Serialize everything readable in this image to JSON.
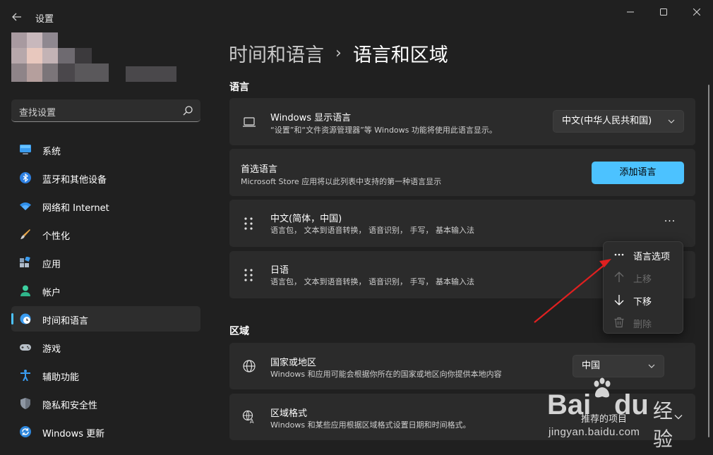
{
  "window": {
    "app_title": "设置",
    "back_icon": "arrow-left-icon",
    "controls": [
      "minimize-icon",
      "maximize-icon",
      "close-icon"
    ]
  },
  "search": {
    "placeholder": "查找设置",
    "icon": "search-icon"
  },
  "nav": {
    "items": [
      {
        "label": "系统",
        "icon": "monitor-icon",
        "active": false
      },
      {
        "label": "蓝牙和其他设备",
        "icon": "bluetooth-icon",
        "active": false
      },
      {
        "label": "网络和 Internet",
        "icon": "wifi-icon",
        "active": false
      },
      {
        "label": "个性化",
        "icon": "paintbrush-icon",
        "active": false
      },
      {
        "label": "应用",
        "icon": "apps-icon",
        "active": false
      },
      {
        "label": "帐户",
        "icon": "person-icon",
        "active": false
      },
      {
        "label": "时间和语言",
        "icon": "clock-globe-icon",
        "active": true
      },
      {
        "label": "游戏",
        "icon": "gamepad-icon",
        "active": false
      },
      {
        "label": "辅助功能",
        "icon": "accessibility-icon",
        "active": false
      },
      {
        "label": "隐私和安全性",
        "icon": "shield-icon",
        "active": false
      },
      {
        "label": "Windows 更新",
        "icon": "update-icon",
        "active": false
      }
    ]
  },
  "breadcrumb": {
    "parent": "时间和语言",
    "separator": "›",
    "current": "语言和区域"
  },
  "language_section": {
    "heading": "语言",
    "display_language": {
      "title": "Windows 显示语言",
      "subtitle": "“设置”和“文件资源管理器”等 Windows 功能将使用此语言显示。",
      "value": "中文(中华人民共和国)",
      "icon": "laptop-icon"
    },
    "preferred": {
      "title": "首选语言",
      "subtitle": "Microsoft Store 应用将以此列表中支持的第一种语言显示",
      "button": "添加语言"
    },
    "languages": [
      {
        "name": "中文(简体，中国)",
        "features": "语言包，  文本到语音转换，  语音识别，  手写，  基本输入法"
      },
      {
        "name": "日语",
        "features": "语言包，  文本到语音转换，  语音识别，  手写，  基本输入法"
      }
    ],
    "more_label": "···"
  },
  "context_menu": {
    "items": [
      {
        "label": "语言选项",
        "icon": "more-icon",
        "enabled": true
      },
      {
        "label": "上移",
        "icon": "arrow-up-icon",
        "enabled": false
      },
      {
        "label": "下移",
        "icon": "arrow-down-icon",
        "enabled": true
      },
      {
        "label": "删除",
        "icon": "trash-icon",
        "enabled": false
      }
    ]
  },
  "region_section": {
    "heading": "区域",
    "country": {
      "title": "国家或地区",
      "subtitle": "Windows 和应用可能会根据你所在的国家或地区向你提供本地内容",
      "value": "中国",
      "icon": "globe-icon"
    },
    "format": {
      "title": "区域格式",
      "subtitle": "Windows 和某些应用根据区域格式设置日期和时间格式。",
      "value": "推荐的项目",
      "icon": "region-format-icon"
    }
  },
  "watermark": {
    "brand": "Bai",
    "brand_suffix": "du",
    "cn": "经验",
    "url": "jingyan.baidu.com"
  },
  "colors": {
    "accent": "#4cc2ff",
    "background": "#202020",
    "card": "#2b2b2b",
    "annotation_arrow": "#e02020"
  }
}
